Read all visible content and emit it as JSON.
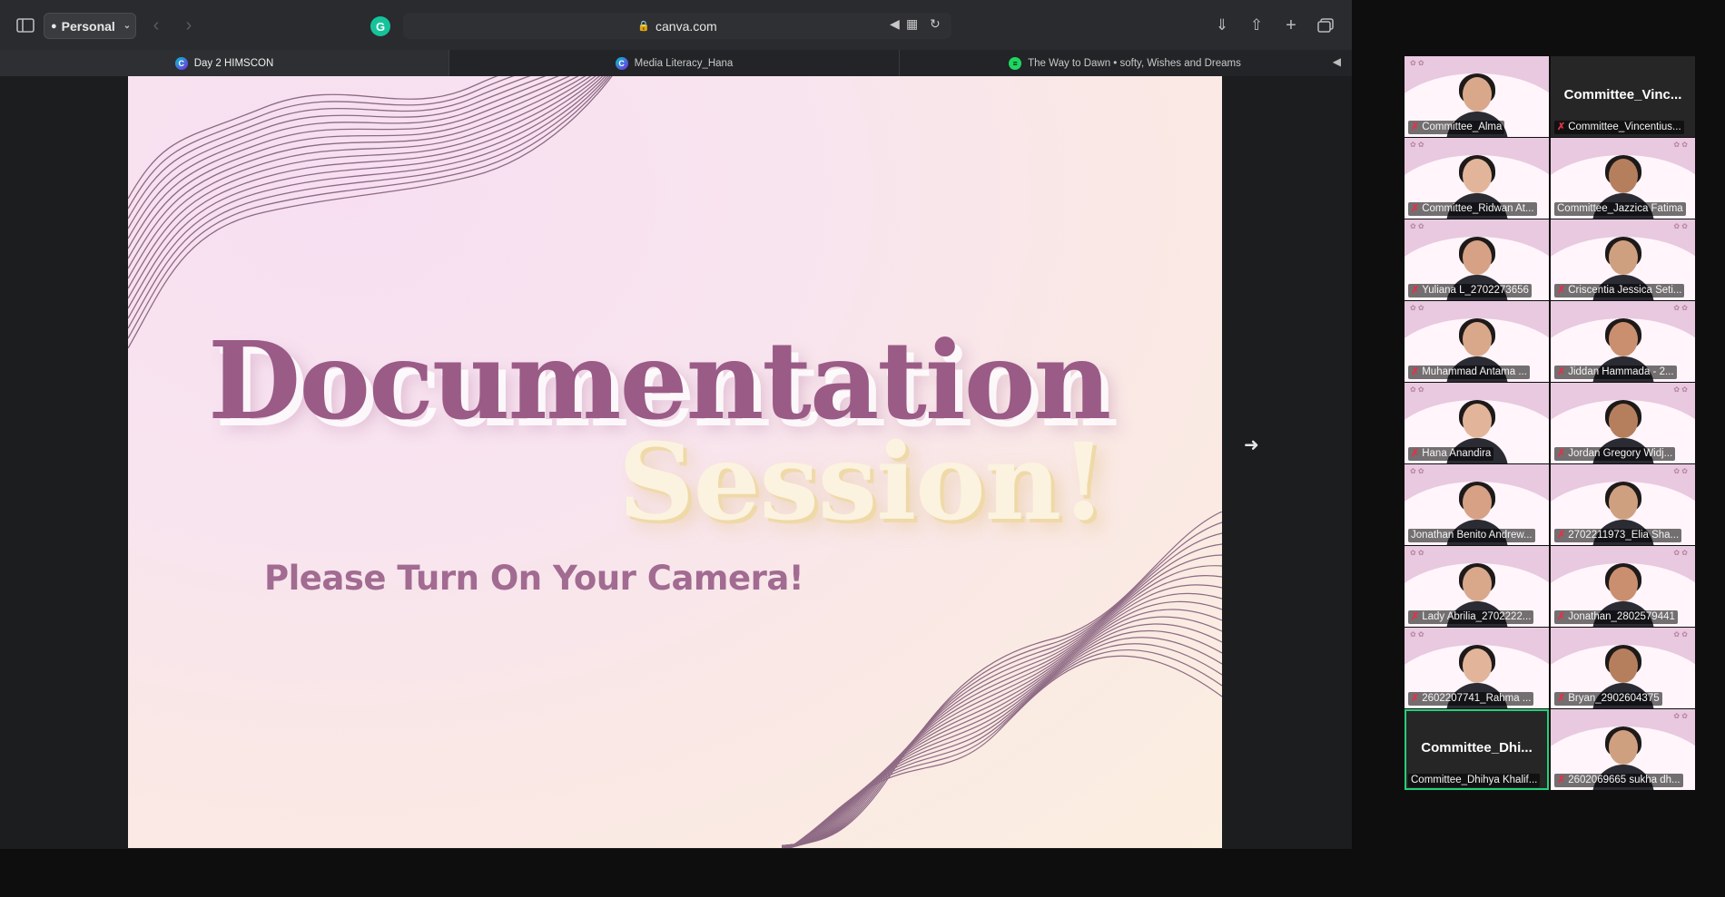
{
  "browser": {
    "profile_label": "Personal",
    "address": "canva.com",
    "tabs": [
      {
        "label": "Day 2 HIMSCON",
        "favicon": "canva-icon",
        "active": true
      },
      {
        "label": "Media Literacy_Hana",
        "favicon": "canva-icon",
        "active": false
      },
      {
        "label": "The Way to Dawn • softy, Wishes and Dreams",
        "favicon": "spotify-icon",
        "active": false
      }
    ]
  },
  "slide": {
    "title_line1": "Documentation",
    "title_line2": "Session!",
    "subtitle": "Please Turn On Your Camera!",
    "colors": {
      "title": "#9a5b86",
      "accent": "#fbf3df",
      "subtitle": "#a26b91"
    }
  },
  "participants": [
    {
      "name": "Committee_Alma",
      "muted": true,
      "video": true
    },
    {
      "name": "Committee_Vincentius...",
      "big_name": "Committee_Vinc...",
      "muted": true,
      "video": false
    },
    {
      "name": "Committee_Ridwan At...",
      "muted": true,
      "video": true
    },
    {
      "name": "Committee_Jazzica Fatima",
      "muted": false,
      "video": true
    },
    {
      "name": "Yuliana L_2702273656",
      "muted": true,
      "video": true
    },
    {
      "name": "Criscentia Jessica Seti...",
      "muted": true,
      "video": true
    },
    {
      "name": "Muhammad Antama ...",
      "muted": true,
      "video": true
    },
    {
      "name": "Jiddan Hammada - 2...",
      "muted": true,
      "video": true
    },
    {
      "name": "Hana Anandira",
      "muted": true,
      "video": true
    },
    {
      "name": "Jordan Gregory Widj...",
      "muted": true,
      "video": true
    },
    {
      "name": "Jonathan Benito Andrew...",
      "muted": false,
      "video": true
    },
    {
      "name": "2702211973_Elia Sha...",
      "muted": true,
      "video": true
    },
    {
      "name": "Lady Abrilia_2702222...",
      "muted": true,
      "video": true
    },
    {
      "name": "Jonathan_2802579441",
      "muted": true,
      "video": true
    },
    {
      "name": "2602207741_Rahma ...",
      "muted": true,
      "video": true
    },
    {
      "name": "Bryan_2902604375",
      "muted": true,
      "video": true
    },
    {
      "name": "Committee_Dhihya Khalif...",
      "big_name": "Committee_Dhi...",
      "muted": false,
      "video": false,
      "active_speaker": true
    },
    {
      "name": "2602069665 sukha dh...",
      "muted": true,
      "video": true
    }
  ]
}
